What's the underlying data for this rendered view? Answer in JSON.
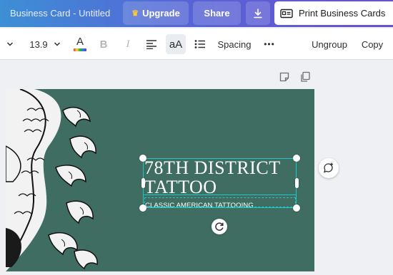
{
  "header": {
    "doc_title": "Business Card - Untitled",
    "upgrade_label": "Upgrade",
    "share_label": "Share",
    "print_label": "Print Business Cards"
  },
  "toolbar": {
    "font_size": "13.9",
    "font_case_label": "aA",
    "spacing_label": "Spacing",
    "more_label": "•••",
    "ungroup_label": "Ungroup",
    "copy_label": "Copy",
    "bold_label": "B",
    "italic_label": "I",
    "text_color_label": "A"
  },
  "card": {
    "title_line1": "78TH DISTRICT",
    "title_line2": "TATTOO",
    "subtitle": "CLASSIC AMERICAN TATTOOING"
  },
  "colors": {
    "card_background": "#406d62",
    "selection": "#1ec6c6",
    "header_gradient_start": "#3d8fd6",
    "header_gradient_end": "#6a4fd0"
  }
}
